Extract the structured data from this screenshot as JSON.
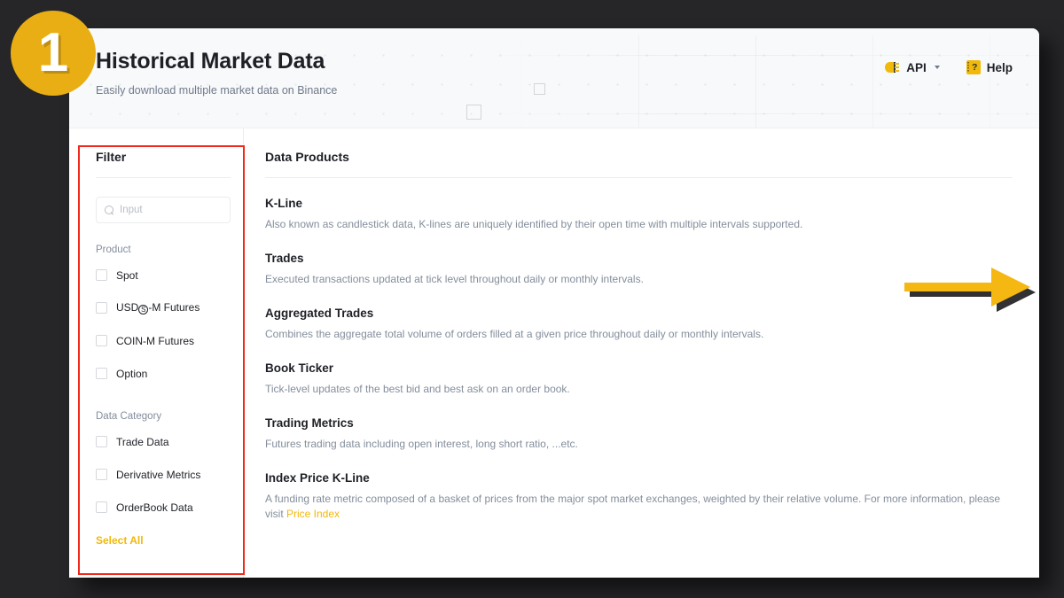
{
  "header": {
    "title": "Historical Market Data",
    "subtitle": "Easily download multiple market data on Binance",
    "api_label": "API",
    "api_icon": "api-icon",
    "api_caret": "chevron-down-icon",
    "help_label": "Help",
    "help_icon": "help-book-icon",
    "help_glyph": "?"
  },
  "sidebar": {
    "title": "Filter",
    "search": {
      "value": "",
      "placeholder": "Input",
      "icon": "search-icon"
    },
    "groups": [
      {
        "label": "Product",
        "items": [
          {
            "label": "Spot",
            "checked": false
          },
          {
            "label": "USD",
            "label_suffix": "-M Futures",
            "circle": "S",
            "checked": false
          },
          {
            "label": "COIN-M Futures",
            "checked": false
          },
          {
            "label": "Option",
            "checked": false
          }
        ]
      },
      {
        "label": "Data Category",
        "items": [
          {
            "label": "Trade Data",
            "checked": false
          },
          {
            "label": "Derivative Metrics",
            "checked": false
          },
          {
            "label": "OrderBook Data",
            "checked": false
          }
        ]
      }
    ],
    "select_all": "Select All"
  },
  "main": {
    "title": "Data Products",
    "products": [
      {
        "name": "K-Line",
        "desc": "Also known as candlestick data, K-lines are uniquely identified by their open time with multiple intervals supported."
      },
      {
        "name": "Trades",
        "desc": "Executed transactions updated at tick level throughout daily or monthly intervals."
      },
      {
        "name": "Aggregated Trades",
        "desc": "Combines the aggregate total volume of orders filled at a given price throughout daily or monthly intervals."
      },
      {
        "name": "Book Ticker",
        "desc": "Tick-level updates of the best bid and best ask on an order book."
      },
      {
        "name": "Trading Metrics",
        "desc": "Futures trading data including open interest, long short ratio, ...etc."
      },
      {
        "name": "Index Price K-Line",
        "desc": "A funding rate metric composed of a basket of prices from the major spot market exchanges, weighted by their relative volume. For more information, please visit ",
        "link_text": "Price Index"
      }
    ]
  },
  "annotations": {
    "step_number": "1",
    "highlight_color": "#f0291b",
    "badge_color": "#e8ae14",
    "arrow_color": "#f0b90b",
    "arrow_direction": "right"
  },
  "colors": {
    "accent": "#f0b90b",
    "text": "#1e2026",
    "muted": "#848e9c",
    "background": "#262629",
    "card": "#ffffff"
  }
}
